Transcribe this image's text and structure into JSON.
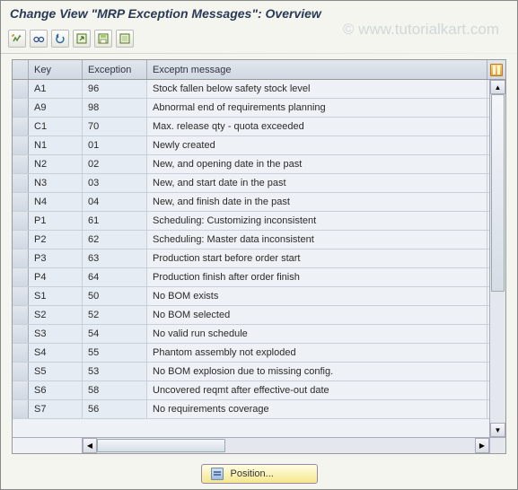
{
  "title": "Change View \"MRP Exception Messages\": Overview",
  "watermark": "© www.tutorialkart.com",
  "toolbar": {
    "icons": [
      {
        "name": "other-view-icon"
      },
      {
        "name": "glasses-icon"
      },
      {
        "name": "undo-icon"
      },
      {
        "name": "expand-icon"
      },
      {
        "name": "save-icon"
      },
      {
        "name": "select-all-icon"
      }
    ]
  },
  "columns": {
    "key": "Key",
    "exception": "Exception",
    "message": "Exceptn message"
  },
  "rows": [
    {
      "key": "A1",
      "exception": "96",
      "message": "Stock fallen below safety stock level"
    },
    {
      "key": "A9",
      "exception": "98",
      "message": "Abnormal end of requirements planning"
    },
    {
      "key": "C1",
      "exception": "70",
      "message": "Max. release qty - quota exceeded"
    },
    {
      "key": "N1",
      "exception": "01",
      "message": "Newly created"
    },
    {
      "key": "N2",
      "exception": "02",
      "message": "New, and opening date in the past"
    },
    {
      "key": "N3",
      "exception": "03",
      "message": "New, and start date in the past"
    },
    {
      "key": "N4",
      "exception": "04",
      "message": "New, and finish date in the past"
    },
    {
      "key": "P1",
      "exception": "61",
      "message": "Scheduling: Customizing inconsistent"
    },
    {
      "key": "P2",
      "exception": "62",
      "message": "Scheduling: Master data inconsistent"
    },
    {
      "key": "P3",
      "exception": "63",
      "message": "Production start before order start"
    },
    {
      "key": "P4",
      "exception": "64",
      "message": "Production finish after order finish"
    },
    {
      "key": "S1",
      "exception": "50",
      "message": "No BOM exists"
    },
    {
      "key": "S2",
      "exception": "52",
      "message": "No BOM selected"
    },
    {
      "key": "S3",
      "exception": "54",
      "message": "No valid run schedule"
    },
    {
      "key": "S4",
      "exception": "55",
      "message": "Phantom assembly not exploded"
    },
    {
      "key": "S5",
      "exception": "53",
      "message": "No BOM explosion due to missing config."
    },
    {
      "key": "S6",
      "exception": "58",
      "message": "Uncovered reqmt after effective-out date"
    },
    {
      "key": "S7",
      "exception": "56",
      "message": "No requirements coverage"
    }
  ],
  "footer": {
    "position_label": "Position..."
  }
}
